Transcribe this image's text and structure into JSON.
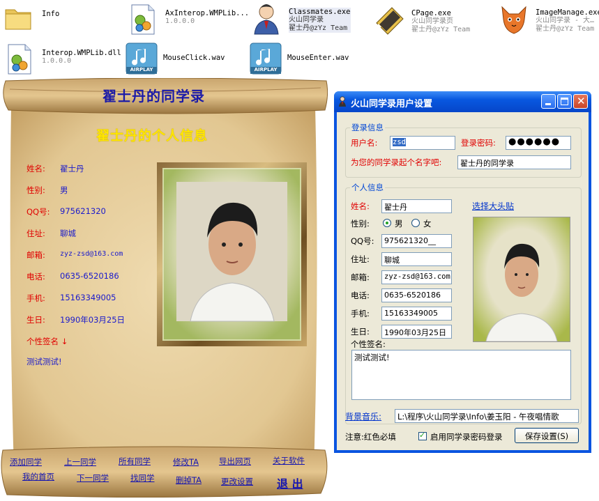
{
  "desktop": {
    "files": [
      {
        "name": "Info",
        "sub1": "",
        "sub2": "",
        "icon": "folder-icon"
      },
      {
        "name": "AxInterop.WMPLib...",
        "sub1": "1.0.0.0",
        "sub2": "",
        "icon": "dll-gear-icon"
      },
      {
        "name": "Classmates.exe",
        "sub1": "火山同学录",
        "sub2": "翟士丹@zYz Team",
        "icon": "user-person-icon"
      },
      {
        "name": "CPage.exe",
        "sub1": "火山同学录页",
        "sub2": "翟士丹@zYz Team",
        "icon": "notebook-icon"
      },
      {
        "name": "ImageManage.exe",
        "sub1": "火山同学录 - 大…",
        "sub2": "翟士丹@zYz Team",
        "icon": "fox-icon"
      },
      {
        "name": "Interop.WMPLib.dll",
        "sub1": "1.0.0.0",
        "sub2": "",
        "icon": "dll-gear-icon"
      },
      {
        "name": "MouseClick.wav",
        "sub1": "",
        "sub2": "",
        "icon": "airplay-audio-icon",
        "badge": "AIRPLAY"
      },
      {
        "name": "MouseEnter.wav",
        "sub1": "",
        "sub2": "",
        "icon": "airplay-audio-icon",
        "badge": "AIRPLAY"
      }
    ]
  },
  "scroll": {
    "title": "翟士丹的同学录",
    "subtitle": "翟士丹的个人信息",
    "fields": [
      {
        "label": "姓名:",
        "value": "翟士丹"
      },
      {
        "label": "性别:",
        "value": "男"
      },
      {
        "label": "QQ号:",
        "value": "975621320"
      },
      {
        "label": "住址:",
        "value": "聊城"
      },
      {
        "label": "邮箱:",
        "value": "zyz-zsd@163.com"
      },
      {
        "label": "电话:",
        "value": "0635-6520186"
      },
      {
        "label": "手机:",
        "value": "15163349005"
      },
      {
        "label": "生日:",
        "value": "1990年03月25日"
      }
    ],
    "signature_label": "个性签名 ↓",
    "signature": "测试测试!",
    "nav": [
      "添加同学",
      "上一同学",
      "所有同学",
      "修改TA",
      "导出网页",
      "关于软件",
      "我的首页",
      "下一同学",
      "找同学",
      "删掉TA",
      "更改设置",
      "退 出"
    ]
  },
  "settings": {
    "title": "火山同学录用户设置",
    "login_group": "登录信息",
    "username_label": "用户名:",
    "username": "zsd",
    "password_label": "登录密码:",
    "password_mask": "●●●●●●",
    "book_name_label": "为您的同学录起个名字吧:",
    "book_name": "翟士丹的同学录",
    "personal_group": "个人信息",
    "name_label": "姓名:",
    "name": "翟士丹",
    "gender_label": "性别:",
    "gender_male": "男",
    "gender_female": "女",
    "qq_label": "QQ号:",
    "qq": "975621320__",
    "address_label": "住址:",
    "address": "聊城",
    "email_label": "邮箱:",
    "email": "zyz-zsd@163.com",
    "phone_label": "电话:",
    "phone": "0635-6520186",
    "mobile_label": "手机:",
    "mobile": "15163349005",
    "birthday_label": "生日:",
    "birthday": "1990年03月25日",
    "choose_photo": "选择大头贴",
    "signature_label": "个性签名:",
    "signature": "测试测试!",
    "music_label": "背景音乐:",
    "music_path": "L:\\程序\\火山同学录\\Info\\姜玉阳 - 午夜唱情歌",
    "note": "注意:红色必填",
    "enable_password_label": "启用同学录密码登录",
    "save_button": "保存设置(S)"
  }
}
